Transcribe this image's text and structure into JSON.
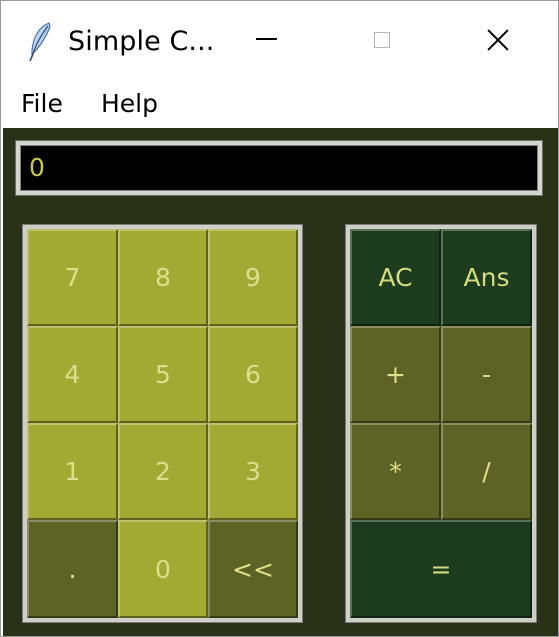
{
  "window": {
    "title": "Simple C...",
    "app_icon": "feather-icon",
    "controls": {
      "minimize": "minimize-icon",
      "maximize": "maximize-icon",
      "close": "close-icon"
    }
  },
  "menu": {
    "file": "File",
    "help": "Help"
  },
  "display": {
    "value": "0"
  },
  "keypad": {
    "seven": "7",
    "eight": "8",
    "nine": "9",
    "four": "4",
    "five": "5",
    "six": "6",
    "one": "1",
    "two": "2",
    "three": "3",
    "dot": ".",
    "zero": "0",
    "backspace": "<<"
  },
  "operators": {
    "clear": "AC",
    "answer": "Ans",
    "add": "+",
    "subtract": "-",
    "multiply": "*",
    "divide": "/",
    "equals": "="
  },
  "colors": {
    "background": "#293218",
    "digit_key": "#a3aa34",
    "operator_key": "#5d6325",
    "special_key": "#1d3b1d",
    "key_text": "#dede8c",
    "display_bg": "#000000",
    "display_text": "#c8c85a"
  }
}
